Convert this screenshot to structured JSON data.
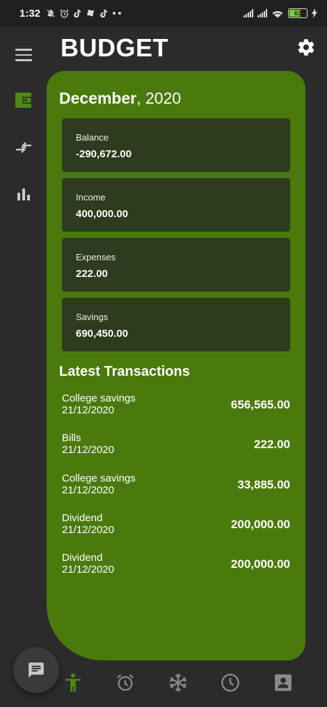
{
  "status_bar": {
    "time": "1:32",
    "battery_level": "61",
    "left_icons": [
      "muted-bell-icon",
      "alarm-icon",
      "tiktok-icon",
      "app-icon",
      "tiktok-icon",
      "more-dots-icon"
    ],
    "right_icons": [
      "signal-icon",
      "signal-icon",
      "wifi-icon",
      "battery-icon",
      "charging-icon"
    ]
  },
  "header": {
    "title": "BUDGET"
  },
  "sidebar": {
    "items": [
      {
        "icon": "wallet-icon",
        "active": true
      },
      {
        "icon": "transfer-arrows-icon",
        "active": false
      },
      {
        "icon": "bar-chart-icon",
        "active": false
      }
    ]
  },
  "period": {
    "month": "December",
    "year": ", 2020"
  },
  "stats": [
    {
      "label": "Balance",
      "value": "-290,672.00"
    },
    {
      "label": "Income",
      "value": "400,000.00"
    },
    {
      "label": "Expenses",
      "value": "222.00"
    },
    {
      "label": "Savings",
      "value": "690,450.00"
    }
  ],
  "transactions": {
    "title": "Latest Transactions",
    "items": [
      {
        "name": "College savings",
        "date": "21/12/2020",
        "amount": "656,565.00"
      },
      {
        "name": "Bills",
        "date": "21/12/2020",
        "amount": "222.00"
      },
      {
        "name": "College savings",
        "date": "21/12/2020",
        "amount": "33,885.00"
      },
      {
        "name": "Dividend",
        "date": "21/12/2020",
        "amount": "200,000.00"
      },
      {
        "name": "Dividend",
        "date": "21/12/2020",
        "amount": "200,000.00"
      }
    ]
  },
  "bottom_nav": {
    "items": [
      "person-icon",
      "alarm-clock-icon",
      "snowflake-icon",
      "clock-icon",
      "contact-card-icon"
    ],
    "active_index": 0
  },
  "colors": {
    "accent": "#4a7a0c",
    "active_icon": "#4f8a10",
    "background": "#2b2b2b",
    "stat_card": "#2e3b1e"
  }
}
